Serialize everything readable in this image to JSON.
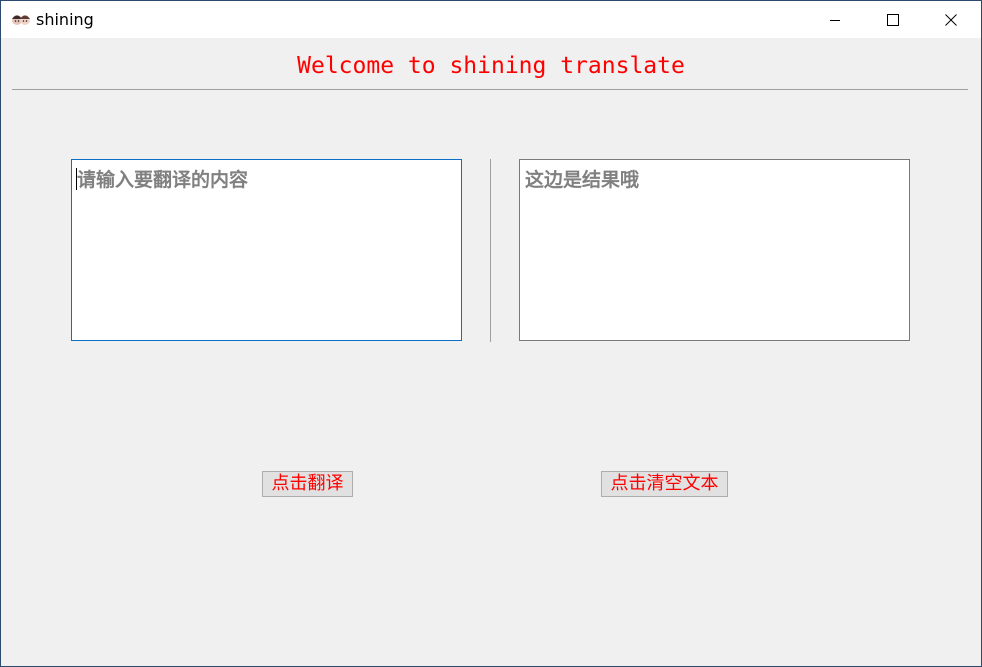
{
  "window": {
    "title": "shining",
    "controls": {
      "minimize_icon": "minimize-icon",
      "maximize_icon": "maximize-icon",
      "close_icon": "close-icon"
    }
  },
  "header": {
    "welcome": "Welcome to shining translate",
    "color": "#ff0000"
  },
  "input": {
    "value": "",
    "placeholder": "请输入要翻译的内容"
  },
  "output": {
    "value": "",
    "placeholder": "这边是结果哦"
  },
  "buttons": {
    "translate_label": "点击翻译",
    "clear_label": "点击清空文本"
  },
  "colors": {
    "accent": "#ff0000",
    "placeholder": "#808080",
    "focus_border": "#0b6fc3",
    "background": "#f0f0f0"
  }
}
